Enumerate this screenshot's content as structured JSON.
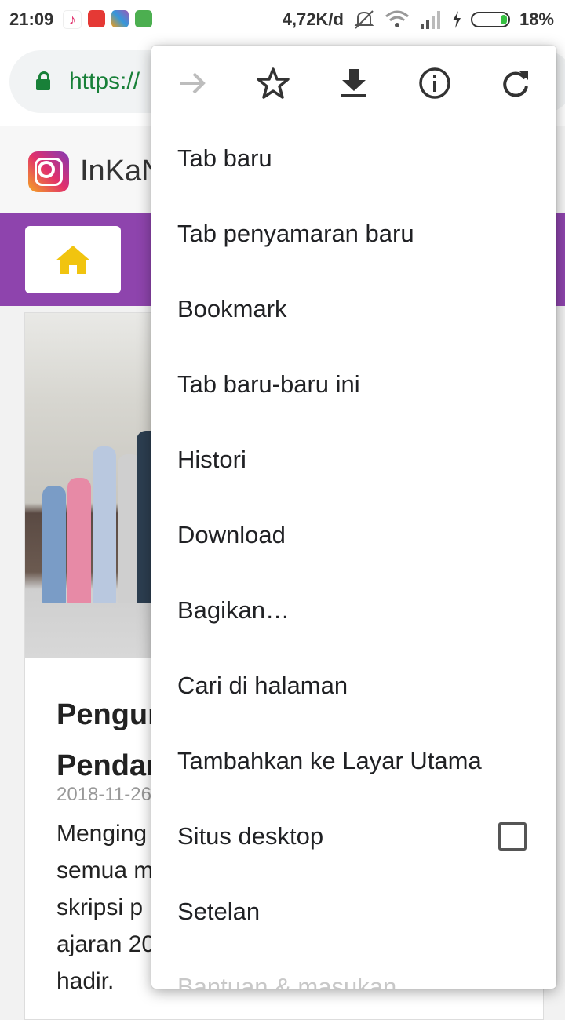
{
  "status_bar": {
    "time": "21:09",
    "network_speed": "4,72K/d",
    "battery": "18%",
    "battery_level": 0.18,
    "app_icons": [
      "tiktok-icon",
      "mail-app-icon",
      "gallery-app-icon",
      "green-app-icon"
    ],
    "status_icons": [
      "mute-icon",
      "wifi-icon",
      "signal-icon",
      "charging-icon",
      "battery-icon"
    ]
  },
  "browser": {
    "url": "https://"
  },
  "site": {
    "title": "InKaN"
  },
  "article": {
    "title_line1": "Pengur",
    "title_line2": "Pendar",
    "date": "2018-11-26",
    "body_lines": [
      "Menging",
      "semua m",
      "skripsi p",
      "ajaran 20",
      "hadir."
    ]
  },
  "menu": {
    "icons": [
      "forward-icon",
      "bookmark-star-icon",
      "download-icon",
      "info-icon",
      "refresh-icon"
    ],
    "items": [
      {
        "label": "Tab baru"
      },
      {
        "label": "Tab penyamaran baru"
      },
      {
        "label": "Bookmark"
      },
      {
        "label": "Tab baru-baru ini"
      },
      {
        "label": "Histori"
      },
      {
        "label": "Download"
      },
      {
        "label": "Bagikan…"
      },
      {
        "label": "Cari di halaman"
      },
      {
        "label": "Tambahkan ke Layar Utama"
      },
      {
        "label": "Situs desktop",
        "checked": false
      },
      {
        "label": "Setelan"
      },
      {
        "label": "Bantuan & masukan"
      }
    ]
  },
  "colors": {
    "nav_purple": "#8e44ad",
    "home_icon": "#f1c40f",
    "secure_green": "#188038"
  }
}
